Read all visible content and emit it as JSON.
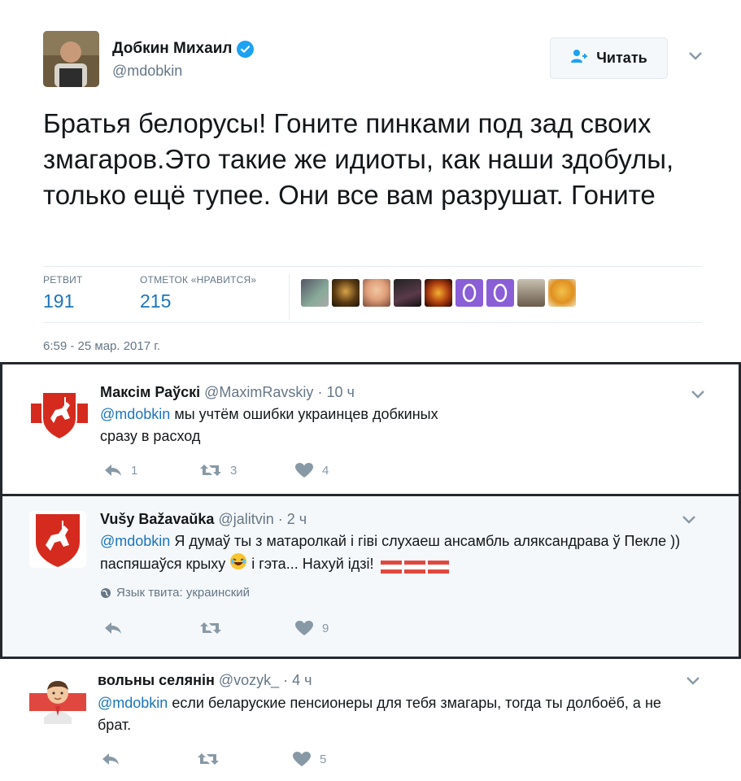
{
  "main_tweet": {
    "author_name": "Добкин Михаил",
    "author_handle": "@mdobkin",
    "follow_label": "Читать",
    "text": "Братья белорусы! Гоните пинками под зад своих змагаров.Это такие же идиоты, как наши здобулы, только ещё тупее. Они все вам разрушат. Гоните",
    "stats": {
      "retweets_label": "РЕТВИТ",
      "retweets_value": "191",
      "likes_label": "ОТМЕТОК «НРАВИТСЯ»",
      "likes_value": "215"
    },
    "timestamp": "6:59 - 25 мар. 2017 г.",
    "accent_color": "#1b75bb",
    "verified_color": "#1da1f2"
  },
  "replies": [
    {
      "name": "Максім Раўскі",
      "handle": "@MaximRavskiy",
      "time": "· 10 ч",
      "mention": "@mdobkin",
      "text": " мы учтём ошибки украинцев добкиных сразу в расход",
      "reply_count": "1",
      "retweet_count": "3",
      "like_count": "4",
      "avatar_icon": "pahonia-flag-icon"
    },
    {
      "name": "Vušy Bažavaŭka",
      "handle": "@jalitvin",
      "time": "· 2 ч",
      "mention": "@mdobkin",
      "text_part1": " Я думаў ты з матаролкай і гіві слухаеш ансамбль аляксандрава ў Пекле )) паспяшаўся крыху ",
      "text_part2": " і гэта... Нахуй ідзі! ",
      "language_note": "Язык твита: украинский",
      "reply_count": "",
      "retweet_count": "",
      "like_count": "9",
      "avatar_icon": "pahonia-shield-icon"
    },
    {
      "name": "вольны селянін",
      "handle": "@vozyk_",
      "time": "· 4 ч",
      "mention": "@mdobkin",
      "text": " если беларуские пенсионеры для тебя змагары, тогда ты долбоёб, а не брат.",
      "reply_count": "",
      "retweet_count": "",
      "like_count": "5",
      "avatar_icon": "cartoon-man-icon"
    }
  ]
}
